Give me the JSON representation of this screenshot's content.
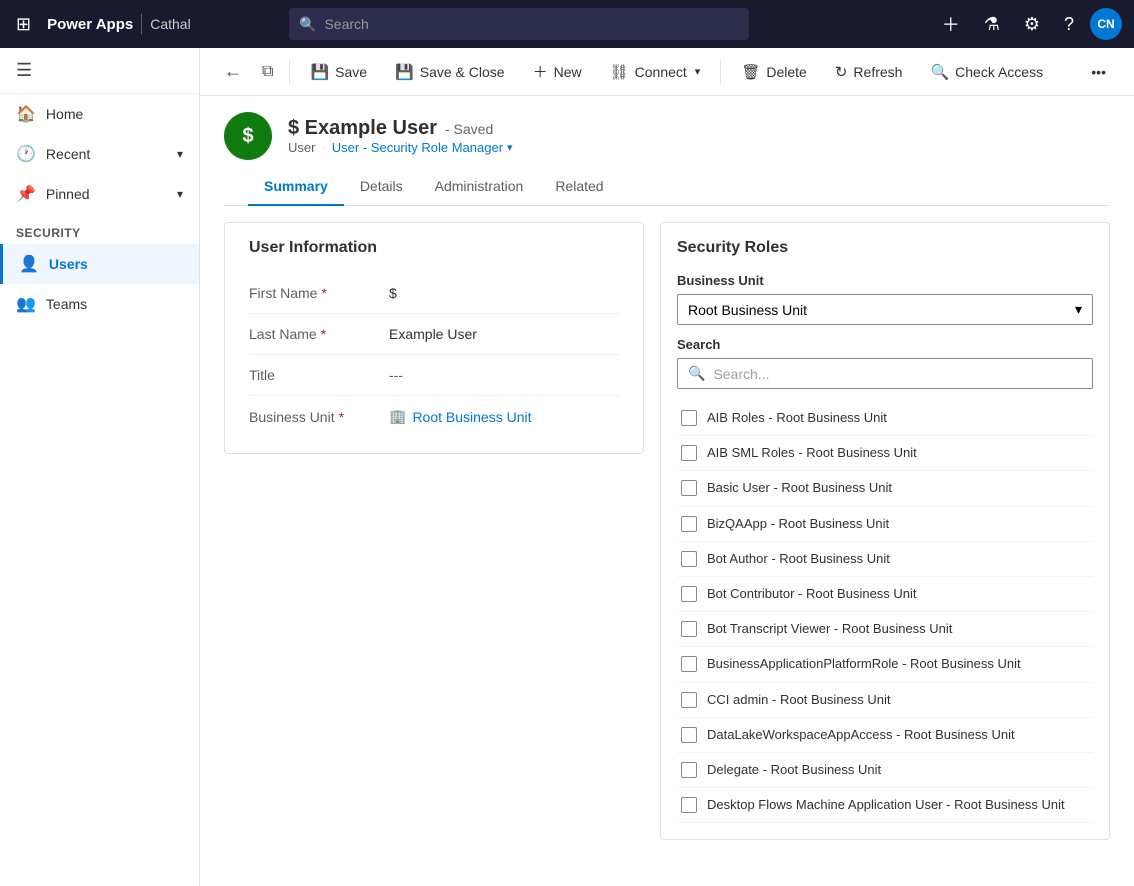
{
  "topbar": {
    "brand": "Power Apps",
    "user_context": "Cathal",
    "search_placeholder": "Search",
    "avatar_initials": "CN",
    "avatar_bg": "#0078d4"
  },
  "command_bar": {
    "save_label": "Save",
    "save_close_label": "Save & Close",
    "new_label": "New",
    "connect_label": "Connect",
    "delete_label": "Delete",
    "refresh_label": "Refresh",
    "check_access_label": "Check Access"
  },
  "page": {
    "avatar_letter": "$",
    "avatar_bg": "#107c10",
    "title": "$ Example User",
    "saved_badge": "- Saved",
    "breadcrumb_user": "User",
    "breadcrumb_role": "User - Security Role Manager",
    "tabs": [
      "Summary",
      "Details",
      "Administration",
      "Related"
    ],
    "active_tab": "Summary"
  },
  "sidebar": {
    "items": [
      {
        "label": "Home",
        "icon": "🏠"
      },
      {
        "label": "Recent",
        "icon": "🕐",
        "has_chevron": true
      },
      {
        "label": "Pinned",
        "icon": "📌",
        "has_chevron": true
      }
    ],
    "section_label": "Security",
    "security_items": [
      {
        "label": "Users",
        "icon": "👤",
        "active": true
      },
      {
        "label": "Teams",
        "icon": "👥",
        "active": false
      }
    ]
  },
  "user_info": {
    "card_title": "User Information",
    "fields": [
      {
        "label": "First Name",
        "required": true,
        "value": "$",
        "type": "text"
      },
      {
        "label": "Last Name",
        "required": true,
        "value": "Example User",
        "type": "text"
      },
      {
        "label": "Title",
        "required": false,
        "value": "---",
        "type": "empty"
      },
      {
        "label": "Business Unit",
        "required": true,
        "value": "Root Business Unit",
        "type": "link"
      }
    ]
  },
  "security_roles": {
    "panel_title": "Security Roles",
    "business_unit_label": "Business Unit",
    "business_unit_value": "Root Business Unit",
    "search_label": "Search",
    "search_placeholder": "Search...",
    "roles": [
      {
        "name": "AIB Roles - Root Business Unit",
        "checked": false
      },
      {
        "name": "AIB SML Roles - Root Business Unit",
        "checked": false
      },
      {
        "name": "Basic User - Root Business Unit",
        "checked": false
      },
      {
        "name": "BizQAApp - Root Business Unit",
        "checked": false
      },
      {
        "name": "Bot Author - Root Business Unit",
        "checked": false
      },
      {
        "name": "Bot Contributor - Root Business Unit",
        "checked": false
      },
      {
        "name": "Bot Transcript Viewer - Root Business Unit",
        "checked": false
      },
      {
        "name": "BusinessApplicationPlatformRole - Root Business Unit",
        "checked": false
      },
      {
        "name": "CCI admin - Root Business Unit",
        "checked": false
      },
      {
        "name": "DataLakeWorkspaceAppAccess - Root Business Unit",
        "checked": false
      },
      {
        "name": "Delegate - Root Business Unit",
        "checked": false
      },
      {
        "name": "Desktop Flows Machine Application User - Root Business Unit",
        "checked": false
      }
    ]
  }
}
